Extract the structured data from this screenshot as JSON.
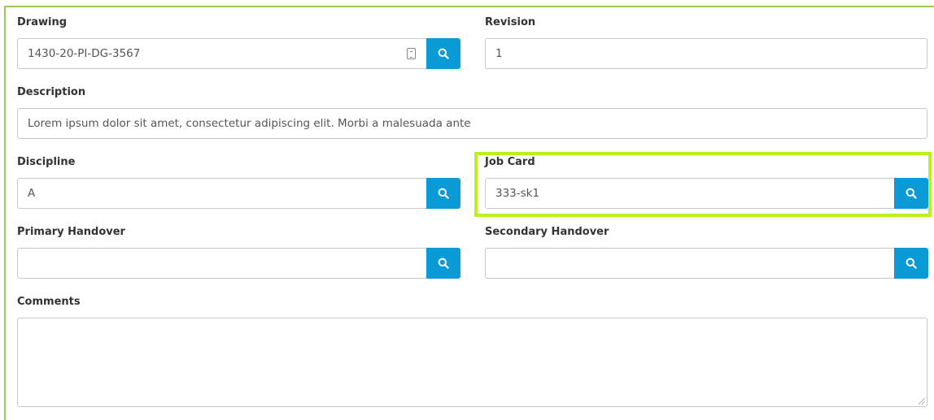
{
  "form": {
    "drawing": {
      "label": "Drawing",
      "value": "1430-20-PI-DG-3567"
    },
    "revision": {
      "label": "Revision",
      "value": "1"
    },
    "description": {
      "label": "Description",
      "value": "Lorem ipsum dolor sit amet, consectetur adipiscing elit. Morbi a malesuada ante"
    },
    "discipline": {
      "label": "Discipline",
      "value": "A"
    },
    "job_card": {
      "label": "Job Card",
      "value": "333-sk1"
    },
    "primary_handover": {
      "label": "Primary Handover",
      "value": ""
    },
    "secondary_handover": {
      "label": "Secondary Handover",
      "value": ""
    },
    "comments": {
      "label": "Comments",
      "value": ""
    }
  },
  "icons": {
    "search": "search-icon",
    "copy": "copy-icon",
    "resize": "resize-handle-icon"
  },
  "colors": {
    "frame_border": "#8fd14f",
    "highlight_border": "#b7f21c",
    "search_button": "#0a9ad6"
  }
}
